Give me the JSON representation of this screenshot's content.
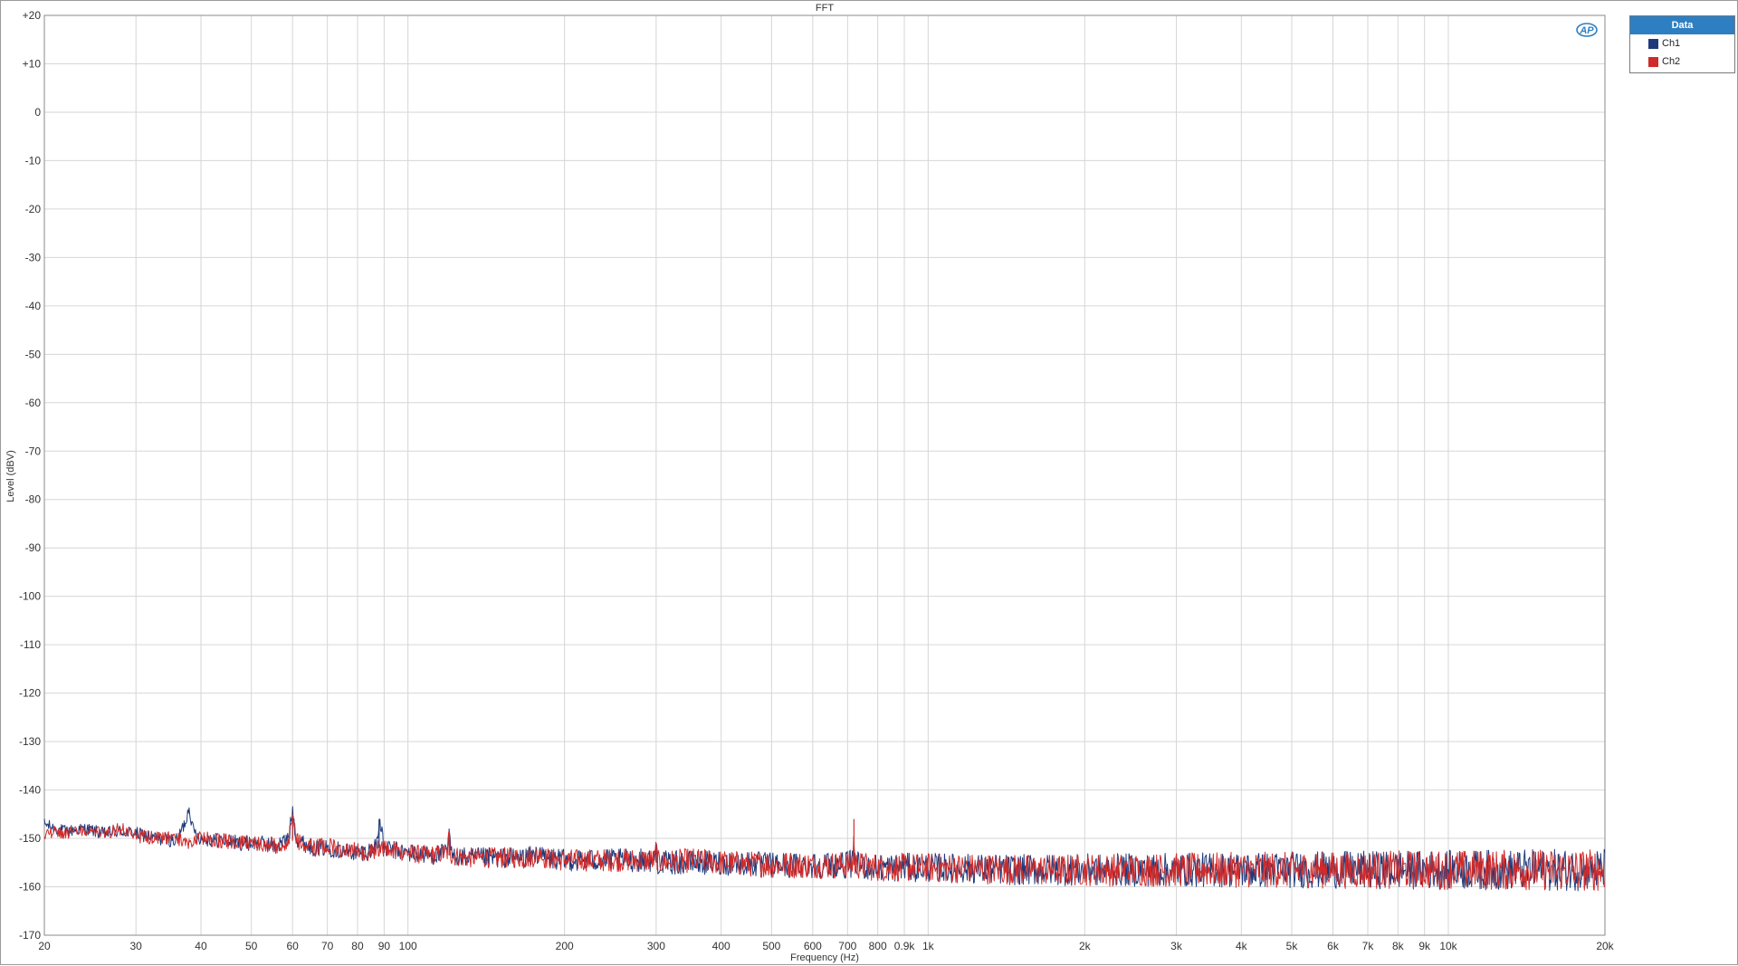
{
  "chart_data": {
    "type": "line",
    "title": "FFT",
    "xlabel": "Frequency (Hz)",
    "ylabel": "Level (dBV)",
    "x_scale": "log",
    "xlim": [
      20,
      20000
    ],
    "ylim": [
      -170,
      20
    ],
    "grid": true,
    "legend_placement": "right-top",
    "legend_title": "Data",
    "x_ticks": [
      {
        "value": 20,
        "label": "20"
      },
      {
        "value": 30,
        "label": "30"
      },
      {
        "value": 40,
        "label": "40"
      },
      {
        "value": 50,
        "label": "50"
      },
      {
        "value": 60,
        "label": "60"
      },
      {
        "value": 70,
        "label": "70"
      },
      {
        "value": 80,
        "label": "80"
      },
      {
        "value": 90,
        "label": "90"
      },
      {
        "value": 100,
        "label": "100"
      },
      {
        "value": 200,
        "label": "200"
      },
      {
        "value": 300,
        "label": "300"
      },
      {
        "value": 400,
        "label": "400"
      },
      {
        "value": 500,
        "label": "500"
      },
      {
        "value": 600,
        "label": "600"
      },
      {
        "value": 700,
        "label": "700"
      },
      {
        "value": 800,
        "label": "800"
      },
      {
        "value": 900,
        "label": "0.9k"
      },
      {
        "value": 1000,
        "label": "1k"
      },
      {
        "value": 2000,
        "label": "2k"
      },
      {
        "value": 3000,
        "label": "3k"
      },
      {
        "value": 4000,
        "label": "4k"
      },
      {
        "value": 5000,
        "label": "5k"
      },
      {
        "value": 6000,
        "label": "6k"
      },
      {
        "value": 7000,
        "label": "7k"
      },
      {
        "value": 8000,
        "label": "8k"
      },
      {
        "value": 9000,
        "label": "9k"
      },
      {
        "value": 10000,
        "label": "10k"
      },
      {
        "value": 20000,
        "label": "20k"
      }
    ],
    "y_ticks": [
      {
        "value": 20,
        "label": "+20"
      },
      {
        "value": 10,
        "label": "+10"
      },
      {
        "value": 0,
        "label": "0"
      },
      {
        "value": -10,
        "label": "-10"
      },
      {
        "value": -20,
        "label": "-20"
      },
      {
        "value": -30,
        "label": "-30"
      },
      {
        "value": -40,
        "label": "-40"
      },
      {
        "value": -50,
        "label": "-50"
      },
      {
        "value": -60,
        "label": "-60"
      },
      {
        "value": -70,
        "label": "-70"
      },
      {
        "value": -80,
        "label": "-80"
      },
      {
        "value": -90,
        "label": "-90"
      },
      {
        "value": -100,
        "label": "-100"
      },
      {
        "value": -110,
        "label": "-110"
      },
      {
        "value": -120,
        "label": "-120"
      },
      {
        "value": -130,
        "label": "-130"
      },
      {
        "value": -140,
        "label": "-140"
      },
      {
        "value": -150,
        "label": "-150"
      },
      {
        "value": -160,
        "label": "-160"
      },
      {
        "value": -170,
        "label": "-170"
      }
    ],
    "series": [
      {
        "name": "Ch1",
        "color": "#1f3a7a",
        "x": [
          20,
          21,
          22,
          24,
          26,
          28,
          30,
          33,
          36,
          37.5,
          38,
          38.5,
          40,
          44,
          48,
          52,
          56,
          59,
          60,
          61,
          63,
          66,
          70,
          75,
          80,
          85,
          87,
          88,
          90,
          95,
          100,
          110,
          119,
          120,
          121,
          130,
          150,
          170,
          179,
          180,
          181,
          200,
          250,
          298,
          300,
          302,
          350,
          400,
          500,
          600,
          700,
          718,
          720,
          722,
          800,
          900,
          1000,
          1500,
          2000,
          3000,
          4000,
          5000,
          6000,
          7000,
          8000,
          9000,
          10000,
          12000,
          15000,
          18000,
          20000
        ],
        "y": [
          -147,
          -148,
          -148.5,
          -148,
          -149,
          -148.5,
          -149,
          -150,
          -150.5,
          -146,
          -143,
          -148,
          -150,
          -150.5,
          -151,
          -151,
          -151.5,
          -150,
          -144,
          -150,
          -151,
          -152,
          -152,
          -152.5,
          -153,
          -152.5,
          -151,
          -146,
          -152,
          -152.5,
          -153,
          -153.5,
          -153,
          -148,
          -153.5,
          -154,
          -154,
          -154,
          -153,
          -151,
          -154,
          -154.5,
          -154.5,
          -154.5,
          -151,
          -155,
          -155,
          -155,
          -155.5,
          -155.5,
          -155.5,
          -155,
          -154,
          -155.5,
          -156,
          -156,
          -156,
          -156.5,
          -156.5,
          -156.5,
          -156.5,
          -156.5,
          -156.5,
          -156.5,
          -156.5,
          -156.5,
          -156.5,
          -156.5,
          -156.5,
          -156.5,
          -156.5
        ]
      },
      {
        "name": "Ch2",
        "color": "#d12a2a",
        "x": [
          20,
          21,
          22,
          24,
          26,
          28,
          30,
          33,
          36,
          38,
          40,
          44,
          48,
          52,
          56,
          59,
          60,
          61,
          63,
          66,
          70,
          75,
          80,
          85,
          88,
          90,
          95,
          100,
          110,
          119,
          120,
          121,
          130,
          150,
          170,
          179,
          180,
          181,
          200,
          250,
          298,
          300,
          302,
          350,
          400,
          500,
          600,
          700,
          718,
          720,
          722,
          800,
          900,
          1000,
          1500,
          2000,
          3000,
          4000,
          5000,
          6000,
          7000,
          8000,
          9000,
          10000,
          12000,
          15000,
          18000,
          20000
        ],
        "y": [
          -149,
          -148.5,
          -149,
          -148.5,
          -149,
          -148,
          -149.5,
          -150,
          -150,
          -151,
          -150,
          -150.5,
          -151,
          -151,
          -151.5,
          -150.5,
          -145,
          -150.5,
          -151,
          -152,
          -151.5,
          -152.5,
          -152.5,
          -153,
          -152,
          -152,
          -152.5,
          -153,
          -153.5,
          -153,
          -149,
          -153.5,
          -154,
          -154,
          -154,
          -153.5,
          -151,
          -154,
          -154.5,
          -154.5,
          -154.5,
          -152,
          -155,
          -154.5,
          -155,
          -155.5,
          -155.5,
          -155.5,
          -155,
          -146,
          -155.5,
          -156,
          -156,
          -156,
          -156.5,
          -156.5,
          -156.5,
          -156.5,
          -156.5,
          -156.5,
          -156.5,
          -156.5,
          -156.5,
          -156.5,
          -156.5,
          -156.5,
          -156.5,
          -156.5
        ]
      }
    ]
  }
}
